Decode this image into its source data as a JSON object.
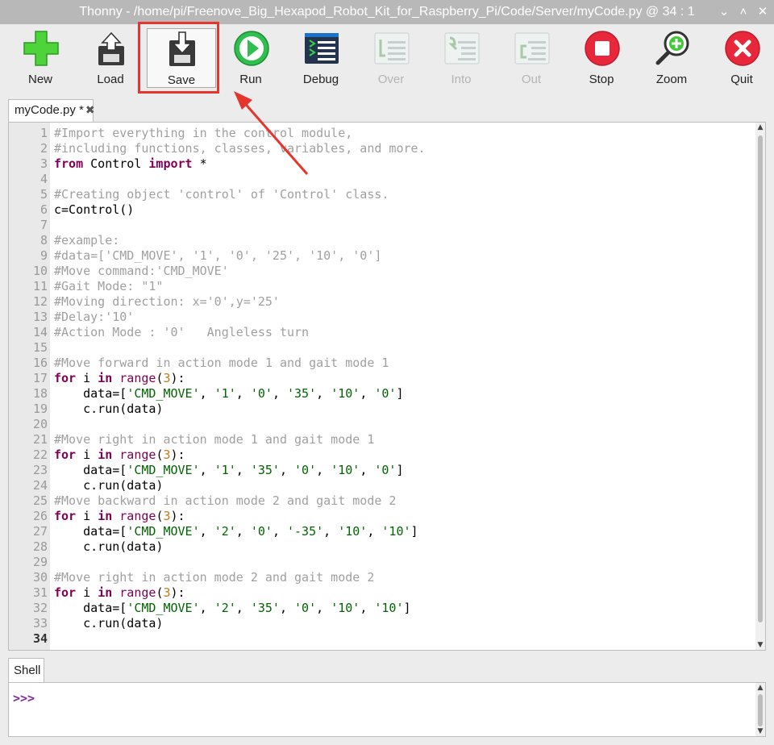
{
  "window": {
    "title": "Thonny  -  /home/pi/Freenove_Big_Hexapod_Robot_Kit_for_Raspberry_Pi/Code/Server/myCode.py  @  34 : 1",
    "minimize": "⌄",
    "maximize": "˄",
    "close": "✕"
  },
  "toolbar": {
    "new": "New",
    "load": "Load",
    "save": "Save",
    "run": "Run",
    "debug": "Debug",
    "over": "Over",
    "into": "Into",
    "out": "Out",
    "stop": "Stop",
    "zoom": "Zoom",
    "quit": "Quit"
  },
  "editor": {
    "tab_label": "myCode.py *",
    "tab_close": "✖",
    "current_line": 34,
    "lines": [
      [
        [
          "cm",
          "#Import everything in the control module,"
        ]
      ],
      [
        [
          "cm",
          "#including functions, classes, variables, and more."
        ]
      ],
      [
        [
          "kw",
          "from"
        ],
        [
          "df",
          " Control "
        ],
        [
          "kw",
          "import"
        ],
        [
          "df",
          " *"
        ]
      ],
      [],
      [
        [
          "cm",
          "#Creating object 'control' of 'Control' class."
        ]
      ],
      [
        [
          "df",
          "c=Control()"
        ]
      ],
      [],
      [
        [
          "cm",
          "#example:"
        ]
      ],
      [
        [
          "cm",
          "#data=['CMD_MOVE', '1', '0', '25', '10', '0']"
        ]
      ],
      [
        [
          "cm",
          "#Move command:'CMD_MOVE'"
        ]
      ],
      [
        [
          "cm",
          "#Gait Mode: \"1\""
        ]
      ],
      [
        [
          "cm",
          "#Moving direction: x='0',y='25'"
        ]
      ],
      [
        [
          "cm",
          "#Delay:'10'"
        ]
      ],
      [
        [
          "cm",
          "#Action Mode : '0'   Angleless turn"
        ]
      ],
      [],
      [
        [
          "cm",
          "#Move forward in action mode 1 and gait mode 1"
        ]
      ],
      [
        [
          "kw",
          "for"
        ],
        [
          "df",
          " i "
        ],
        [
          "kw",
          "in"
        ],
        [
          "df",
          " "
        ],
        [
          "bi",
          "range"
        ],
        [
          "df",
          "("
        ],
        [
          "nm",
          "3"
        ],
        [
          "df",
          "):"
        ]
      ],
      [
        [
          "df",
          "    data=["
        ],
        [
          "st",
          "'CMD_MOVE'"
        ],
        [
          "df",
          ", "
        ],
        [
          "st",
          "'1'"
        ],
        [
          "df",
          ", "
        ],
        [
          "st",
          "'0'"
        ],
        [
          "df",
          ", "
        ],
        [
          "st",
          "'35'"
        ],
        [
          "df",
          ", "
        ],
        [
          "st",
          "'10'"
        ],
        [
          "df",
          ", "
        ],
        [
          "st",
          "'0'"
        ],
        [
          "df",
          "]"
        ]
      ],
      [
        [
          "df",
          "    c.run(data)"
        ]
      ],
      [],
      [
        [
          "cm",
          "#Move right in action mode 1 and gait mode 1"
        ]
      ],
      [
        [
          "kw",
          "for"
        ],
        [
          "df",
          " i "
        ],
        [
          "kw",
          "in"
        ],
        [
          "df",
          " "
        ],
        [
          "bi",
          "range"
        ],
        [
          "df",
          "("
        ],
        [
          "nm",
          "3"
        ],
        [
          "df",
          "):"
        ]
      ],
      [
        [
          "df",
          "    data=["
        ],
        [
          "st",
          "'CMD_MOVE'"
        ],
        [
          "df",
          ", "
        ],
        [
          "st",
          "'1'"
        ],
        [
          "df",
          ", "
        ],
        [
          "st",
          "'35'"
        ],
        [
          "df",
          ", "
        ],
        [
          "st",
          "'0'"
        ],
        [
          "df",
          ", "
        ],
        [
          "st",
          "'10'"
        ],
        [
          "df",
          ", "
        ],
        [
          "st",
          "'0'"
        ],
        [
          "df",
          "]"
        ]
      ],
      [
        [
          "df",
          "    c.run(data)"
        ]
      ],
      [
        [
          "cm",
          "#Move backward in action mode 2 and gait mode 2"
        ]
      ],
      [
        [
          "kw",
          "for"
        ],
        [
          "df",
          " i "
        ],
        [
          "kw",
          "in"
        ],
        [
          "df",
          " "
        ],
        [
          "bi",
          "range"
        ],
        [
          "df",
          "("
        ],
        [
          "nm",
          "3"
        ],
        [
          "df",
          "):"
        ]
      ],
      [
        [
          "df",
          "    data=["
        ],
        [
          "st",
          "'CMD_MOVE'"
        ],
        [
          "df",
          ", "
        ],
        [
          "st",
          "'2'"
        ],
        [
          "df",
          ", "
        ],
        [
          "st",
          "'0'"
        ],
        [
          "df",
          ", "
        ],
        [
          "st",
          "'-35'"
        ],
        [
          "df",
          ", "
        ],
        [
          "st",
          "'10'"
        ],
        [
          "df",
          ", "
        ],
        [
          "st",
          "'10'"
        ],
        [
          "df",
          "]"
        ]
      ],
      [
        [
          "df",
          "    c.run(data)"
        ]
      ],
      [],
      [
        [
          "cm",
          "#Move right in action mode 2 and gait mode 2"
        ]
      ],
      [
        [
          "kw",
          "for"
        ],
        [
          "df",
          " i "
        ],
        [
          "kw",
          "in"
        ],
        [
          "df",
          " "
        ],
        [
          "bi",
          "range"
        ],
        [
          "df",
          "("
        ],
        [
          "nm",
          "3"
        ],
        [
          "df",
          "):"
        ]
      ],
      [
        [
          "df",
          "    data=["
        ],
        [
          "st",
          "'CMD_MOVE'"
        ],
        [
          "df",
          ", "
        ],
        [
          "st",
          "'2'"
        ],
        [
          "df",
          ", "
        ],
        [
          "st",
          "'35'"
        ],
        [
          "df",
          ", "
        ],
        [
          "st",
          "'0'"
        ],
        [
          "df",
          ", "
        ],
        [
          "st",
          "'10'"
        ],
        [
          "df",
          ", "
        ],
        [
          "st",
          "'10'"
        ],
        [
          "df",
          "]"
        ]
      ],
      [
        [
          "df",
          "    c.run(data)"
        ]
      ],
      []
    ]
  },
  "shell": {
    "tab_label": "Shell",
    "prompt": ">>>"
  },
  "colors": {
    "highlight": "#e5352c",
    "comment": "#a0a0a0",
    "keyword": "#7f0055",
    "string": "#006400",
    "number": "#c77817"
  }
}
